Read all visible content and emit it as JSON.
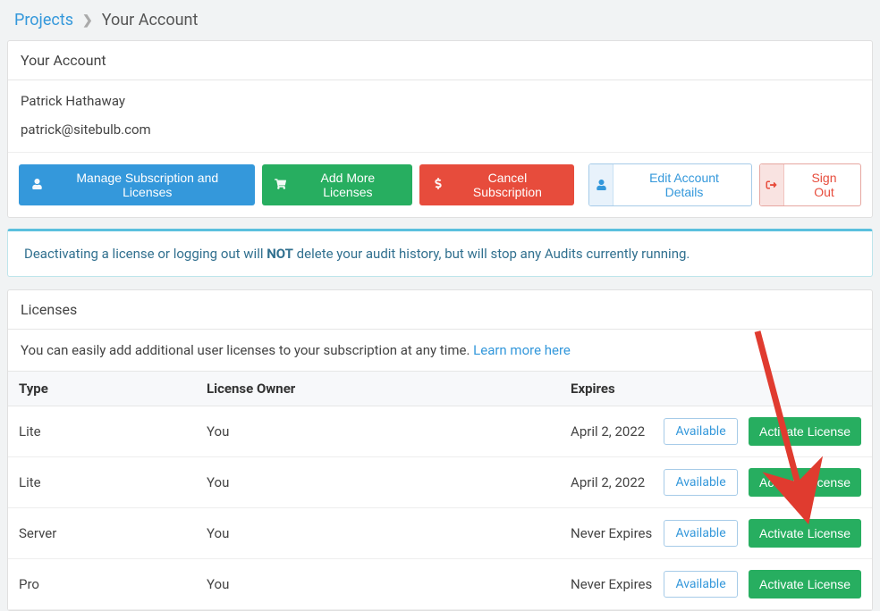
{
  "breadcrumb": {
    "root": "Projects",
    "current": "Your Account"
  },
  "account": {
    "card_title": "Your Account",
    "name": "Patrick Hathaway",
    "email": "patrick@sitebulb.com"
  },
  "buttons": {
    "manage": "Manage Subscription and Licenses",
    "add_more": "Add More Licenses",
    "cancel_sub": "Cancel Subscription",
    "edit_account": "Edit Account Details",
    "sign_out": "Sign Out"
  },
  "alert": {
    "pre": "Deactivating a license or logging out will ",
    "bold": "NOT",
    "post": " delete your audit history, but will stop any Audits currently running."
  },
  "licenses": {
    "title": "Licenses",
    "intro": "You can easily add additional user licenses to your subscription at any time. ",
    "learn": "Learn more here",
    "headers": {
      "type": "Type",
      "owner": "License Owner",
      "expires": "Expires"
    },
    "status_label": "Available",
    "action_label": "Activate License",
    "rows": [
      {
        "type": "Lite",
        "owner": "You",
        "expires": "April 2, 2022"
      },
      {
        "type": "Lite",
        "owner": "You",
        "expires": "April 2, 2022"
      },
      {
        "type": "Server",
        "owner": "You",
        "expires": "Never Expires"
      },
      {
        "type": "Pro",
        "owner": "You",
        "expires": "Never Expires"
      }
    ]
  }
}
